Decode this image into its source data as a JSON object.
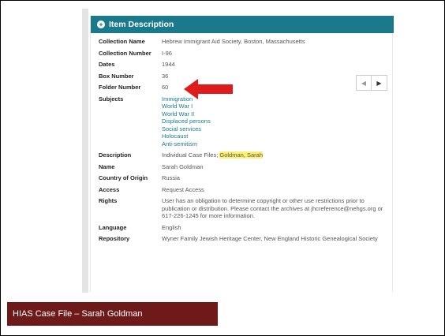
{
  "panel": {
    "header_title": "Item Description",
    "header_icon": "plus-circle-icon",
    "accent_color": "#1a7a8c"
  },
  "fields": {
    "collection_name": {
      "label": "Collection Name",
      "value": "Hebrew Immigrant Aid Society, Boston, Massachusetts"
    },
    "collection_number": {
      "label": "Collection Number",
      "value": "I-96"
    },
    "dates": {
      "label": "Dates",
      "value": "1944"
    },
    "box_number": {
      "label": "Box Number",
      "value": "36"
    },
    "folder_number": {
      "label": "Folder Number",
      "value": "60"
    },
    "subjects": {
      "label": "Subjects",
      "items": [
        "Immigration",
        "World War I",
        "World War II",
        "Displaced persons",
        "Social services",
        "Holocaust",
        "Anti-semitism"
      ]
    },
    "description": {
      "label": "Description",
      "value_prefix": "Individual Case Files; ",
      "value_highlight": "Goldman, Sarah"
    },
    "name": {
      "label": "Name",
      "value": "Sarah Goldman"
    },
    "country": {
      "label": "Country of Origin",
      "value": "Russia"
    },
    "access": {
      "label": "Access",
      "value": "Request Access"
    },
    "rights": {
      "label": "Rights",
      "value": "User has an obligation to determine copyright or other use restrictions prior to publication or distribution. Please contact the archives at jhcreference@nehgs.org or 617-226-1245 for more information."
    },
    "language": {
      "label": "Language",
      "value": "English"
    },
    "repository": {
      "label": "Repository",
      "value": "Wyner Family Jewish Heritage Center, New England Historic Genealogical Society"
    }
  },
  "nav": {
    "prev_icon": "triangle-left-icon",
    "next_icon": "triangle-right-icon",
    "prev_glyph": "◀",
    "next_glyph": "▶"
  },
  "annotation": {
    "arrow_color": "#e01b1b",
    "arrow_icon": "red-arrow-left-icon"
  },
  "caption": {
    "text": "HIAS Case File – Sarah Goldman",
    "bg_color": "#6e1a1a"
  }
}
